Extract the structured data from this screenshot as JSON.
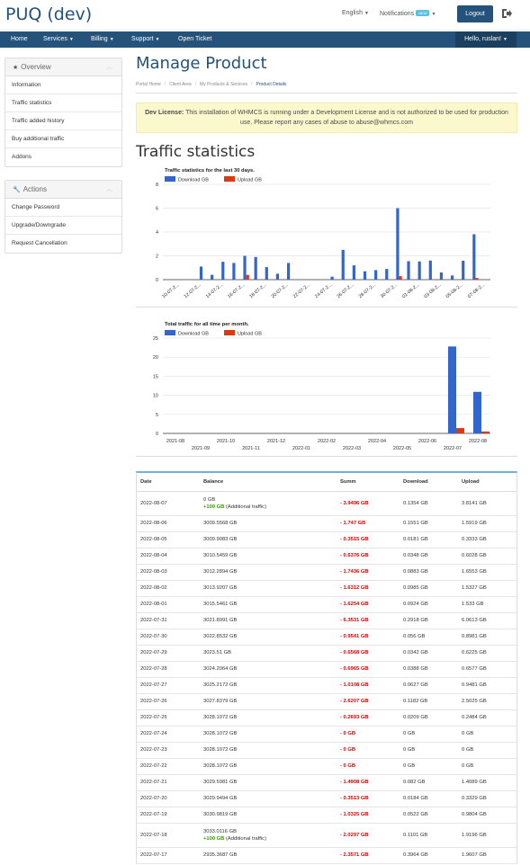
{
  "brand": "PUQ (dev)",
  "topbar": {
    "language": "English",
    "notifications": "Notifications",
    "new_badge": "NEW",
    "logout": "Logout"
  },
  "nav": {
    "items": [
      "Home",
      "Services",
      "Billing",
      "Support",
      "Open Ticket"
    ],
    "hello": "Hello, ruslan!"
  },
  "sidebar": {
    "overview_title": "Overview",
    "overview_items": [
      "Information",
      "Traffic statistics",
      "Traffic added history",
      "Buy additional traffic",
      "Addons"
    ],
    "actions_title": "Actions",
    "actions_items": [
      "Change Password",
      "Upgrade/Downgrade",
      "Request Cancellation"
    ]
  },
  "page": {
    "title": "Manage Product",
    "breadcrumb": [
      "Portal Home",
      "Client Area",
      "My Products & Services",
      "Product Details"
    ],
    "alert_label": "Dev License:",
    "alert_text": "This installation of WHMCS is running under a Development License and is not authorized to be used for production use. Please report any cases of abuse to abuse@whmcs.com",
    "section_title": "Traffic statistics"
  },
  "colors": {
    "download": "#3366cc",
    "upload": "#dc3912",
    "brand": "#24527a"
  },
  "chart_data": [
    {
      "type": "bar",
      "title": "Traffic statistics for the last 30 days.",
      "legend_placement": "top-left",
      "grid": true,
      "ylim": [
        0,
        8
      ],
      "yticks": [
        0,
        2,
        4,
        6,
        8
      ],
      "categories": [
        "2022-07-09",
        "2022-07-10",
        "2022-07-11",
        "2022-07-12",
        "2022-07-13",
        "2022-07-14",
        "2022-07-15",
        "2022-07-16",
        "2022-07-17",
        "2022-07-18",
        "2022-07-19",
        "2022-07-20",
        "2022-07-21",
        "2022-07-22",
        "2022-07-23",
        "2022-07-24",
        "2022-07-25",
        "2022-07-26",
        "2022-07-27",
        "2022-07-28",
        "2022-07-29",
        "2022-07-30",
        "2022-07-31",
        "2022-08-01",
        "2022-08-02",
        "2022-08-03",
        "2022-08-04",
        "2022-08-05",
        "2022-08-06",
        "2022-08-07"
      ],
      "tick_labels": [
        "10-07-2...",
        "12-07-2...",
        "14-07-2...",
        "16-07-2...",
        "18-07-2...",
        "20-07-2...",
        "22-07-2...",
        "24-07-2...",
        "26-07-2...",
        "28-07-2...",
        "30-07-2...",
        "01-08-2...",
        "03-08-2...",
        "05-08-2...",
        "07-08-2..."
      ],
      "series": [
        {
          "name": "Download GB",
          "values": [
            0,
            0,
            0,
            1.1,
            0.4,
            1.5,
            1.4,
            2.0,
            1.9,
            1.05,
            0.5,
            1.4,
            0,
            0,
            0,
            0.25,
            2.5,
            1.2,
            0.7,
            0.8,
            0.9,
            6.0,
            1.55,
            1.53,
            1.6,
            0.6,
            0.35,
            1.59,
            3.81,
            0
          ]
        },
        {
          "name": "Upload GB",
          "values": [
            0,
            0,
            0,
            0,
            0,
            0,
            0,
            0.4,
            0,
            0,
            0,
            0,
            0,
            0,
            0,
            0,
            0,
            0,
            0,
            0,
            0,
            0.29,
            0,
            0,
            0,
            0,
            0,
            0,
            0.14,
            0
          ]
        }
      ]
    },
    {
      "type": "bar",
      "title": "Total traffic for all time per month.",
      "legend_placement": "top-left",
      "grid": true,
      "ylim": [
        0,
        25
      ],
      "yticks": [
        0,
        5,
        10,
        15,
        20,
        25
      ],
      "categories": [
        "2021-08",
        "2021-09",
        "2021-10",
        "2021-11",
        "2021-12",
        "2022-01",
        "2022-02",
        "2022-03",
        "2022-04",
        "2022-05",
        "2022-06",
        "2022-07",
        "2022-08"
      ],
      "series": [
        {
          "name": "Download GB",
          "values": [
            0,
            0,
            0,
            0,
            0,
            0,
            0,
            0,
            0,
            0,
            0,
            22.8,
            10.9
          ]
        },
        {
          "name": "Upload GB",
          "values": [
            0,
            0,
            0,
            0,
            0,
            0,
            0,
            0,
            0,
            0,
            0,
            1.4,
            0.5
          ]
        }
      ]
    }
  ],
  "table": {
    "headers": [
      "Date",
      "Balance",
      "Summ",
      "Download",
      "Upload"
    ],
    "rows": [
      {
        "date": "2022-08-07",
        "balance": "0 GB",
        "extra_amount": "+100 GB",
        "extra_label": "(Additional traffic)",
        "summ": "- 3.9496 GB",
        "download": "0.1354 GB",
        "upload": "3.8141 GB"
      },
      {
        "date": "2022-08-06",
        "balance": "3009.5568 GB",
        "summ": "- 1.747 GB",
        "download": "0.1551 GB",
        "upload": "1.5919 GB"
      },
      {
        "date": "2022-08-05",
        "balance": "3009.9083 GB",
        "summ": "- 0.3515 GB",
        "download": "0.0181 GB",
        "upload": "0.3333 GB"
      },
      {
        "date": "2022-08-04",
        "balance": "3010.5459 GB",
        "summ": "- 0.6376 GB",
        "download": "0.0348 GB",
        "upload": "0.6028 GB"
      },
      {
        "date": "2022-08-03",
        "balance": "3012.2894 GB",
        "summ": "- 1.7436 GB",
        "download": "0.0883 GB",
        "upload": "1.6553 GB"
      },
      {
        "date": "2022-08-02",
        "balance": "3013.9207 GB",
        "summ": "- 1.6312 GB",
        "download": "0.0985 GB",
        "upload": "1.5327 GB"
      },
      {
        "date": "2022-08-01",
        "balance": "3015.5461 GB",
        "summ": "- 1.6254 GB",
        "download": "0.0924 GB",
        "upload": "1.533 GB"
      },
      {
        "date": "2022-07-31",
        "balance": "3021.8991 GB",
        "summ": "- 6.3531 GB",
        "download": "0.2918 GB",
        "upload": "6.0613 GB"
      },
      {
        "date": "2022-07-30",
        "balance": "3022.8532 GB",
        "summ": "- 0.9541 GB",
        "download": "0.056 GB",
        "upload": "0.8981 GB"
      },
      {
        "date": "2022-07-29",
        "balance": "3023.51 GB",
        "summ": "- 0.6568 GB",
        "download": "0.0342 GB",
        "upload": "0.6225 GB"
      },
      {
        "date": "2022-07-28",
        "balance": "3024.2064 GB",
        "summ": "- 0.6965 GB",
        "download": "0.0388 GB",
        "upload": "0.6577 GB"
      },
      {
        "date": "2022-07-27",
        "balance": "3025.2172 GB",
        "summ": "- 1.0108 GB",
        "download": "0.0627 GB",
        "upload": "0.9481 GB"
      },
      {
        "date": "2022-07-26",
        "balance": "3027.8379 GB",
        "summ": "- 2.6207 GB",
        "download": "0.1182 GB",
        "upload": "2.5025 GB"
      },
      {
        "date": "2022-07-25",
        "balance": "3028.1072 GB",
        "summ": "- 0.2693 GB",
        "download": "0.0209 GB",
        "upload": "0.2484 GB"
      },
      {
        "date": "2022-07-24",
        "balance": "3028.1072 GB",
        "summ": "- 0 GB",
        "download": "0 GB",
        "upload": "0 GB"
      },
      {
        "date": "2022-07-23",
        "balance": "3028.1072 GB",
        "summ": "- 0 GB",
        "download": "0 GB",
        "upload": "0 GB"
      },
      {
        "date": "2022-07-22",
        "balance": "3028.1072 GB",
        "summ": "- 0 GB",
        "download": "0 GB",
        "upload": "0 GB"
      },
      {
        "date": "2022-07-21",
        "balance": "3029.5981 GB",
        "summ": "- 1.4908 GB",
        "download": "0.082 GB",
        "upload": "1.4089 GB"
      },
      {
        "date": "2022-07-20",
        "balance": "3029.9494 GB",
        "summ": "- 0.3513 GB",
        "download": "0.0184 GB",
        "upload": "0.3329 GB"
      },
      {
        "date": "2022-07-19",
        "balance": "3030.9819 GB",
        "summ": "- 1.0325 GB",
        "download": "0.0522 GB",
        "upload": "0.9804 GB"
      },
      {
        "date": "2022-07-18",
        "balance": "3033.0116 GB",
        "extra_amount": "+100 GB",
        "extra_label": "(Additional traffic)",
        "summ": "- 2.0297 GB",
        "download": "0.1101 GB",
        "upload": "1.9196 GB"
      },
      {
        "date": "2022-07-17",
        "balance": "2935.3687 GB",
        "summ": "- 2.3571 GB",
        "download": "0.3964 GB",
        "upload": "1.9607 GB"
      }
    ]
  }
}
